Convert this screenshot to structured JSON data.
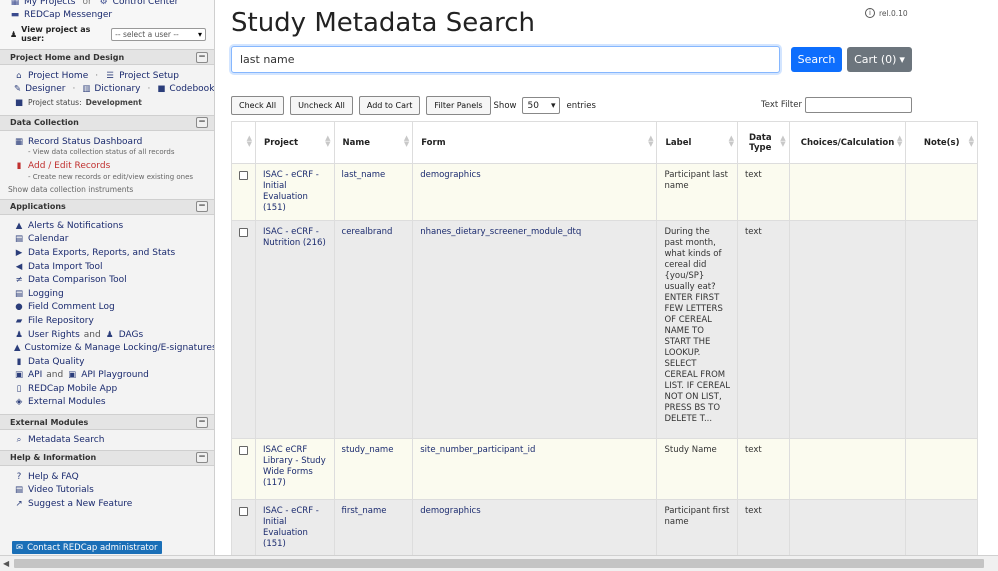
{
  "sidebar": {
    "top": {
      "my_projects": "My Projects",
      "or_text": "or",
      "control_center": "Control Center",
      "messenger": "REDCap Messenger",
      "view_as_label": "View project as user:",
      "view_as_value": "-- select a user --"
    },
    "project_home": {
      "title": "Project Home and Design",
      "project_home": "Project Home",
      "project_setup": "Project Setup",
      "designer": "Designer",
      "dictionary": "Dictionary",
      "codebook": "Codebook",
      "status_label": "Project status:",
      "status_value": "Development"
    },
    "data_collection": {
      "title": "Data Collection",
      "record_status": "Record Status Dashboard",
      "record_status_sub": "- View data collection status of all records",
      "add_edit": "Add / Edit Records",
      "add_edit_sub": "- Create new records or edit/view existing ones",
      "show_instruments": "Show data collection instruments"
    },
    "applications": {
      "title": "Applications",
      "items": [
        {
          "label": "Alerts & Notifications",
          "icon": "bell-icon"
        },
        {
          "label": "Calendar",
          "icon": "calendar-icon"
        },
        {
          "label": "Data Exports, Reports, and Stats",
          "icon": "export-icon"
        },
        {
          "label": "Data Import Tool",
          "icon": "import-icon"
        },
        {
          "label": "Data Comparison Tool",
          "icon": "compare-icon"
        },
        {
          "label": "Logging",
          "icon": "log-icon"
        },
        {
          "label": "Field Comment Log",
          "icon": "comment-icon"
        },
        {
          "label": "File Repository",
          "icon": "folder-icon"
        }
      ],
      "user_rights": "User Rights",
      "and_text": "and",
      "dags": "DAGs",
      "locking": "Customize & Manage Locking/E-signatures",
      "data_quality": "Data Quality",
      "api": "API",
      "api_playground": "API Playground",
      "mobile_app": "REDCap Mobile App",
      "external_modules": "External Modules"
    },
    "external_modules": {
      "title": "External Modules",
      "metadata_search": "Metadata Search"
    },
    "help": {
      "title": "Help & Information",
      "help_faq": "Help & FAQ",
      "video_tutorials": "Video Tutorials",
      "suggest": "Suggest a New Feature"
    },
    "contact": "Contact REDCap administrator"
  },
  "main": {
    "title": "Study Metadata Search",
    "release": "rel.0.10",
    "search_value": "last name",
    "search_button": "Search",
    "cart_button": "Cart (0)",
    "toolbar": {
      "check_all": "Check All",
      "uncheck_all": "Uncheck All",
      "add_to_cart": "Add to Cart",
      "filter_panels": "Filter Panels",
      "show": "Show",
      "entries_value": "50",
      "entries": "entries",
      "text_filter": "Text Filter"
    },
    "table": {
      "headers": [
        "",
        "Project",
        "Name",
        "Form",
        "Label",
        "Data Type",
        "Choices/Calculation",
        "Note(s)"
      ],
      "rows": [
        {
          "project": "ISAC - eCRF - Initial Evaluation (151)",
          "name": "last_name",
          "form": "demographics",
          "label": "Participant last name",
          "type": "text",
          "choices": "",
          "notes": ""
        },
        {
          "project": "ISAC - eCRF - Nutrition (216)",
          "name": "cerealbrand",
          "form": "nhanes_dietary_screener_module_dtq",
          "label": "During the past month, what kinds of cereal did {you/SP} usually eat? ENTER FIRST FEW LETTERS OF CEREAL NAME TO START THE LOOKUP. SELECT CEREAL FROM LIST. IF CEREAL NOT ON LIST, PRESS BS TO DELETE T...",
          "type": "text",
          "choices": "",
          "notes": ""
        },
        {
          "project": "ISAC eCRF Library - Study Wide Forms (117)",
          "name": "study_name",
          "form": "site_number_participant_id",
          "label": "Study Name",
          "type": "text",
          "choices": "",
          "notes": ""
        },
        {
          "project": "ISAC - eCRF - Initial Evaluation (151)",
          "name": "first_name",
          "form": "demographics",
          "label": "Participant first name",
          "type": "text",
          "choices": "",
          "notes": ""
        }
      ]
    }
  }
}
